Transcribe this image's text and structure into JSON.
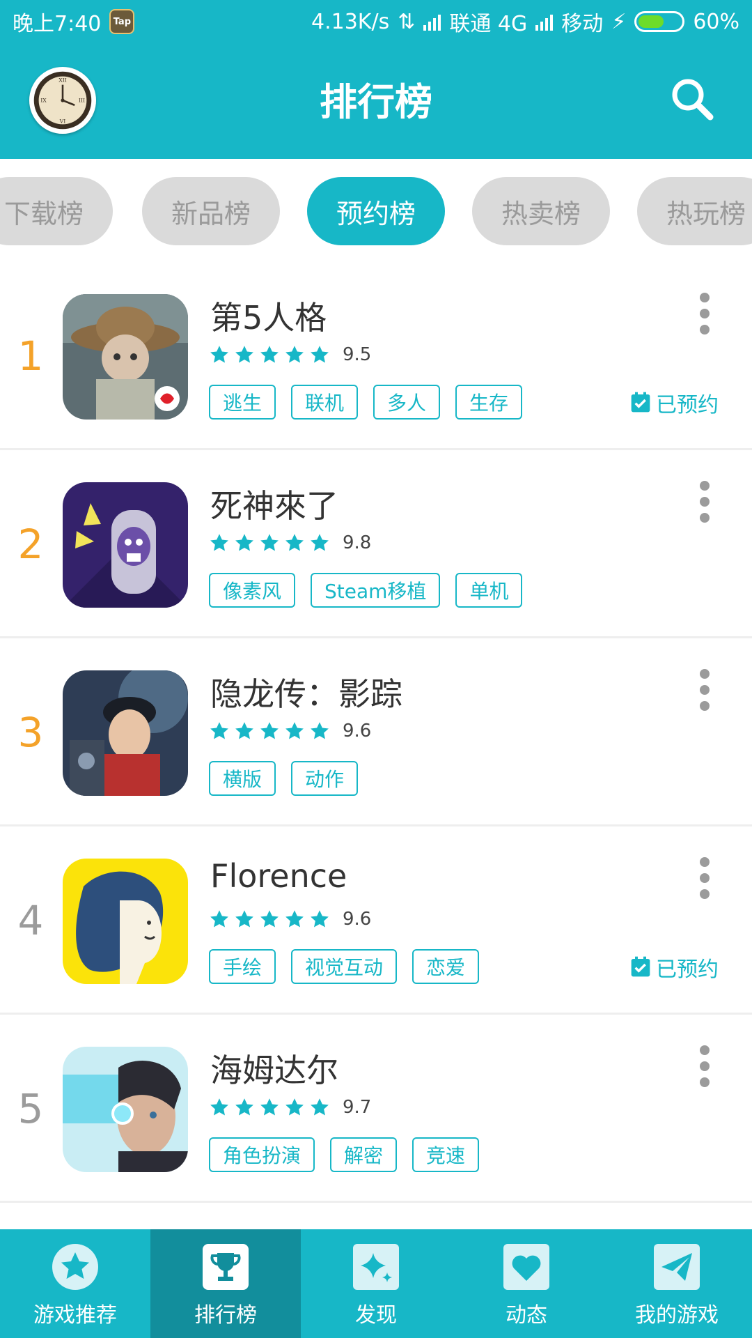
{
  "status_bar": {
    "time": "晚上7:40",
    "app_badge": "TapTap",
    "net_speed": "4.13K/s",
    "carrier1": "联通 4G",
    "carrier2": "移动",
    "battery": "60%",
    "battery_level": 0.6
  },
  "header": {
    "title": "排行榜",
    "avatar_icon": "clock-avatar",
    "search_icon": "search-icon"
  },
  "tabs": [
    {
      "label": "下载榜",
      "active": false
    },
    {
      "label": "新品榜",
      "active": false
    },
    {
      "label": "预约榜",
      "active": true
    },
    {
      "label": "热卖榜",
      "active": false
    },
    {
      "label": "热玩榜",
      "active": false
    }
  ],
  "games": [
    {
      "rank": "1",
      "name": "第5人格",
      "rating": "9.5",
      "tags": [
        "逃生",
        "联机",
        "多人",
        "生存"
      ],
      "reserved": "已预约"
    },
    {
      "rank": "2",
      "name": "死神來了",
      "rating": "9.8",
      "tags": [
        "像素风",
        "Steam移植",
        "单机"
      ],
      "reserved": ""
    },
    {
      "rank": "3",
      "name": "隐龙传：影踪",
      "rating": "9.6",
      "tags": [
        "横版",
        "动作"
      ],
      "reserved": ""
    },
    {
      "rank": "4",
      "name": "Florence",
      "rating": "9.6",
      "tags": [
        "手绘",
        "视觉互动",
        "恋爱"
      ],
      "reserved": "已预约"
    },
    {
      "rank": "5",
      "name": "海姆达尔",
      "rating": "9.7",
      "tags": [
        "角色扮演",
        "解密",
        "竞速"
      ],
      "reserved": ""
    }
  ],
  "bottom_nav": [
    {
      "label": "游戏推荐",
      "icon": "star-icon",
      "active": false
    },
    {
      "label": "排行榜",
      "icon": "trophy-icon",
      "active": true
    },
    {
      "label": "发现",
      "icon": "sparkle-icon",
      "active": false
    },
    {
      "label": "动态",
      "icon": "heart-icon",
      "active": false
    },
    {
      "label": "我的游戏",
      "icon": "paper-plane-icon",
      "active": false
    }
  ],
  "colors": {
    "primary": "#17b7c7",
    "primary_dark": "#128e9c",
    "rank_top": "#f4a229",
    "rank_rest": "#9b9b9b"
  }
}
